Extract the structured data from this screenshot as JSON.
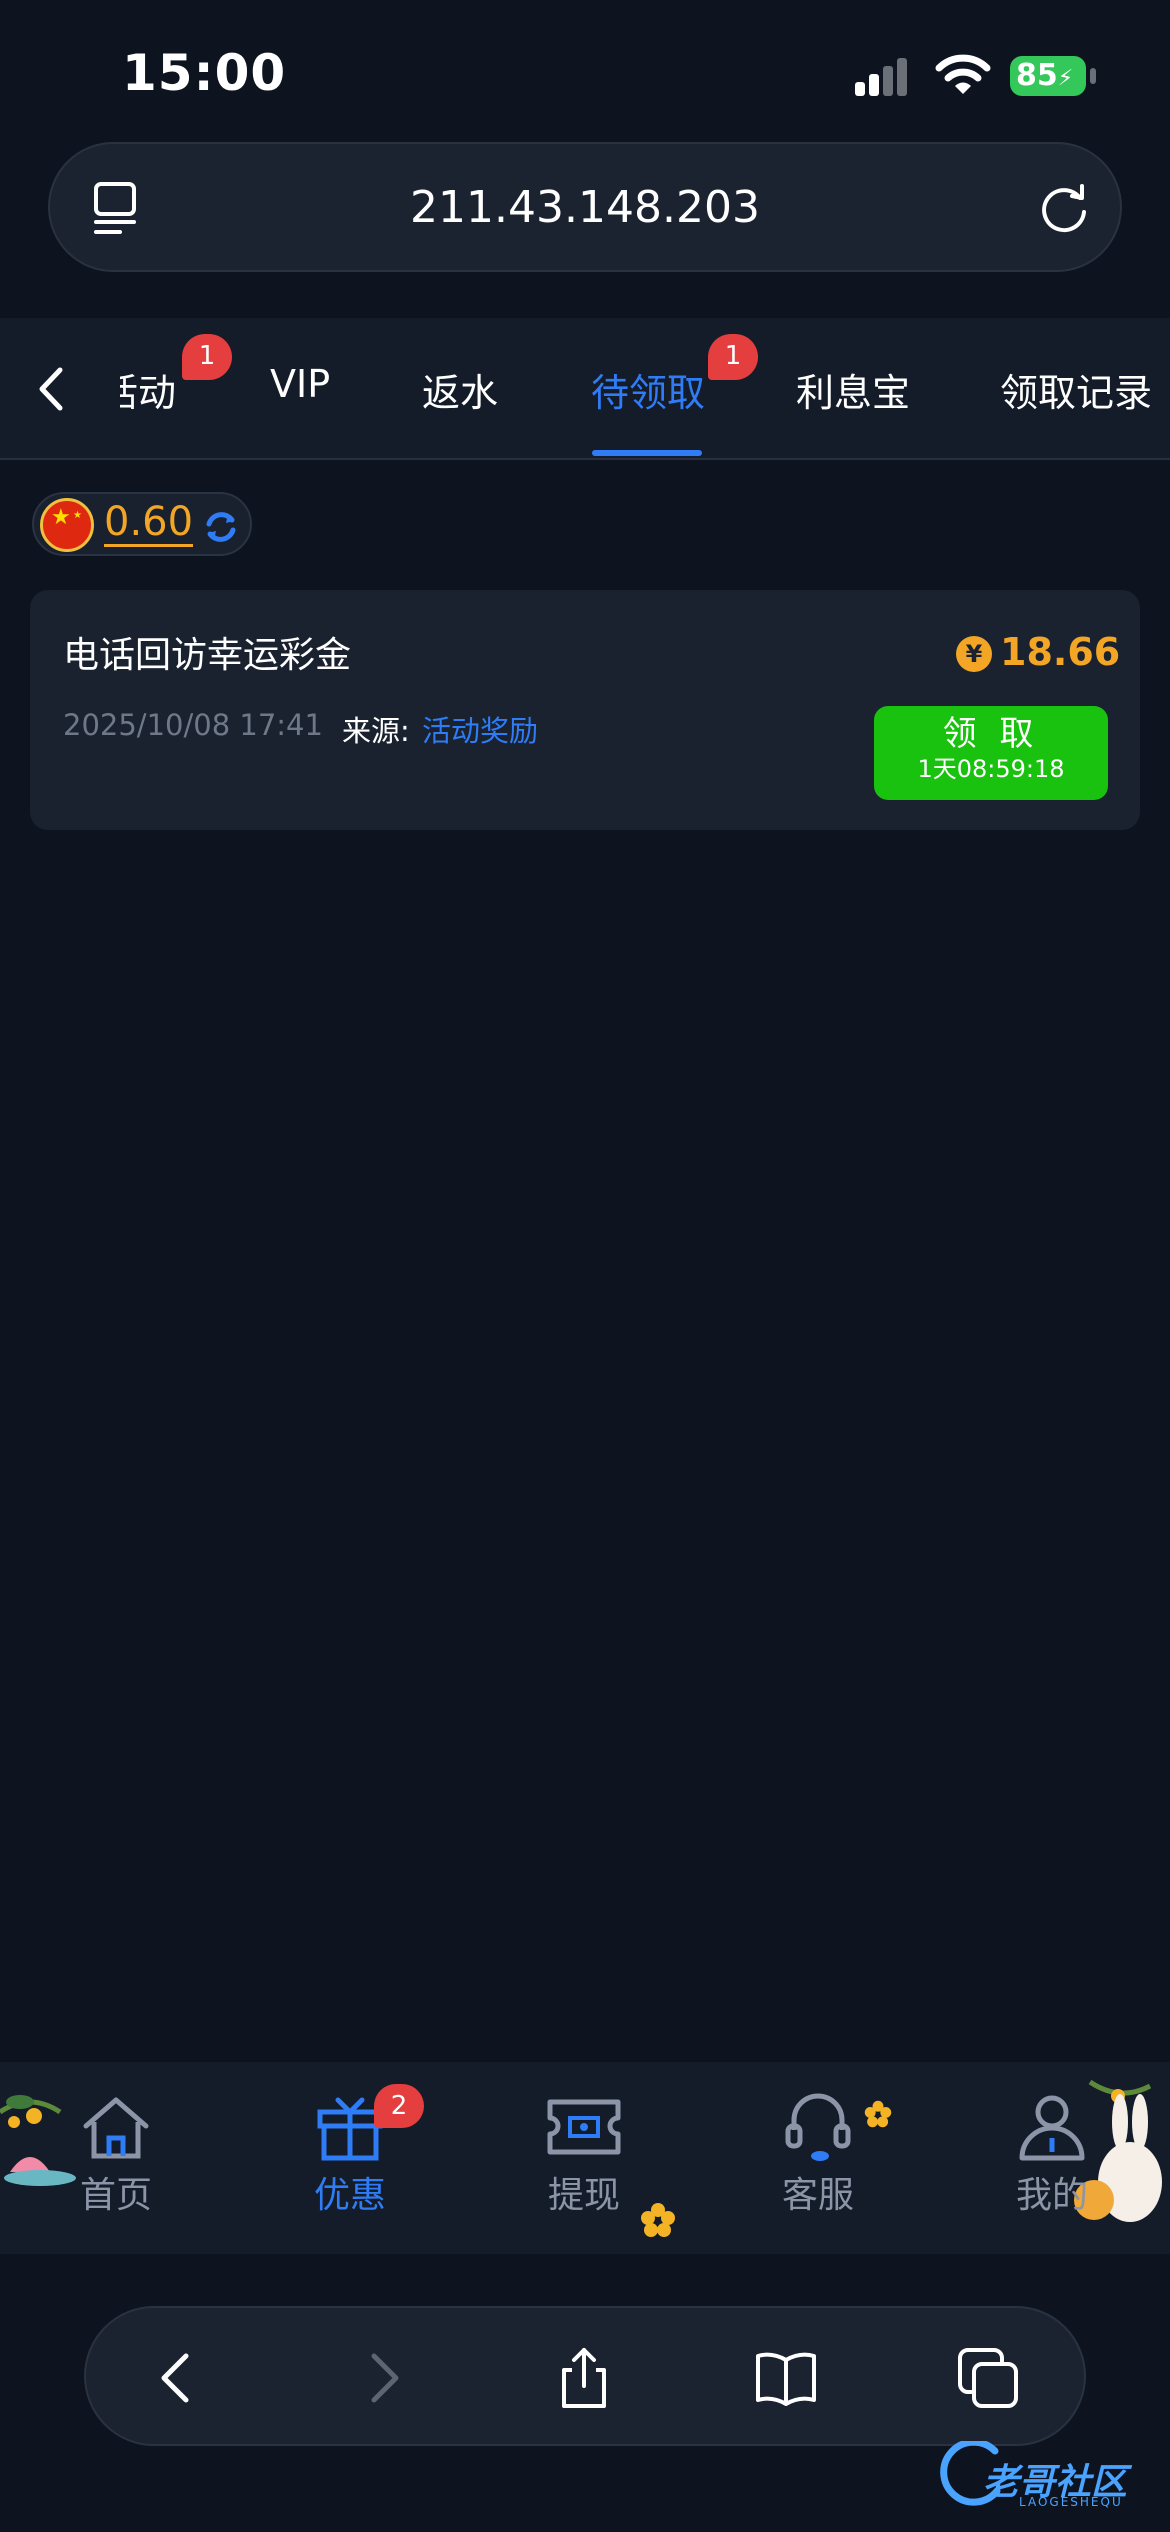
{
  "status_bar": {
    "time": "15:00",
    "battery": "85"
  },
  "browser": {
    "url": "211.43.148.203"
  },
  "tabs": [
    {
      "label": "活动",
      "badge": "1"
    },
    {
      "label": "VIP"
    },
    {
      "label": "返水"
    },
    {
      "label": "待领取",
      "badge": "1",
      "active": true
    },
    {
      "label": "利息宝"
    },
    {
      "label": "领取记录"
    }
  ],
  "balance": {
    "value": "0.60"
  },
  "reward_card": {
    "title": "电话回访幸运彩金",
    "amount": "18.66",
    "coin_symbol": "¥",
    "date": "2025/10/08 17:41",
    "source_label": "来源:",
    "source_value": "活动奖励",
    "claim_label": "领 取",
    "claim_timer": "1天08:59:18"
  },
  "bottom_nav": [
    {
      "label": "首页",
      "icon": "home-icon"
    },
    {
      "label": "优惠",
      "icon": "gift-icon",
      "badge": "2",
      "active": true
    },
    {
      "label": "提现",
      "icon": "withdraw-icon"
    },
    {
      "label": "客服",
      "icon": "headset-icon"
    },
    {
      "label": "我的",
      "icon": "user-icon"
    }
  ],
  "colors": {
    "accent": "#2e7cf6",
    "gold": "#f3a625",
    "claim_green": "#19c20e",
    "badge_red": "#e53e3e",
    "background": "#0d1420"
  }
}
